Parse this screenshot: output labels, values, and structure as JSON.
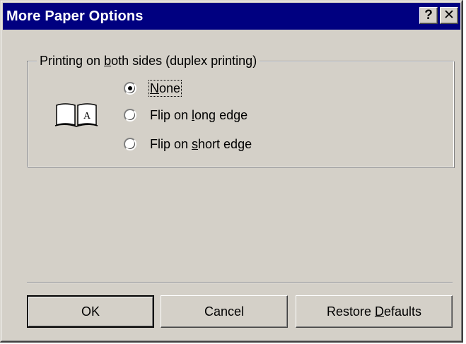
{
  "window": {
    "title": "More Paper Options",
    "help_glyph": "?",
    "close_glyph": "✕"
  },
  "duplex_group": {
    "legend_pre": "Printing on ",
    "legend_accel": "b",
    "legend_post": "oth sides (duplex printing)",
    "icon": "book-duplex-icon",
    "options": [
      {
        "pre": "",
        "accel": "N",
        "post": "one",
        "checked": true,
        "focused": true
      },
      {
        "pre": "Flip on ",
        "accel": "l",
        "post": "ong edge",
        "checked": false,
        "focused": false
      },
      {
        "pre": "Flip on ",
        "accel": "s",
        "post": "hort edge",
        "checked": false,
        "focused": false
      }
    ]
  },
  "buttons": {
    "ok": "OK",
    "cancel": "Cancel",
    "restore_pre": "Restore ",
    "restore_accel": "D",
    "restore_post": "efaults"
  },
  "colors": {
    "title_bar": "#000080",
    "face": "#d4d0c8"
  }
}
